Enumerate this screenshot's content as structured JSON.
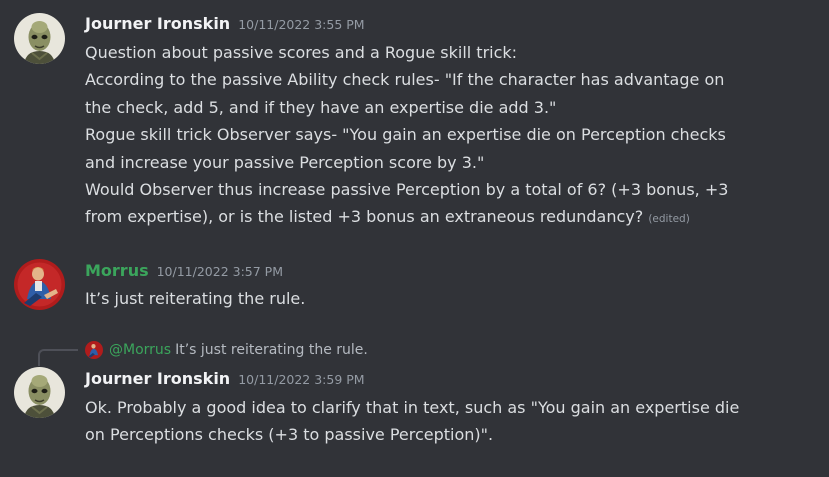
{
  "messages": [
    {
      "username": "Journer Ironskin",
      "timestamp": "10/11/2022 3:55 PM",
      "lines": [
        "Question about passive scores and a Rogue skill trick:",
        "According to the passive Ability check rules- \"If the character has advantage on",
        "the check, add 5, and if they have an expertise die add 3.\"",
        "Rogue skill trick Observer says- \"You gain an expertise die on Perception checks",
        "and increase your passive Perception score by 3.\"",
        "Would Observer thus increase passive Perception by a total of 6? (+3 bonus, +3",
        "from expertise), or is the listed +3 bonus an extraneous redundancy?"
      ],
      "edited_label": "(edited)"
    },
    {
      "username": "Morrus",
      "username_color": "#3ba55c",
      "timestamp": "10/11/2022 3:57 PM",
      "lines": [
        "It’s just reiterating the rule."
      ]
    },
    {
      "reply": {
        "mention": "@Morrus",
        "text": "It’s just reiterating the rule."
      },
      "username": "Journer Ironskin",
      "timestamp": "10/11/2022 3:59 PM",
      "lines": [
        "Ok. Probably a good idea to clarify that in text, such as \"You gain an expertise die",
        "on Perceptions checks (+3 to passive Perception)\"."
      ]
    }
  ],
  "colors": {
    "background": "#313338",
    "text": "#dbdee1",
    "muted": "#949ba4",
    "username": "#f2f3f5",
    "morrus": "#3ba55c"
  }
}
